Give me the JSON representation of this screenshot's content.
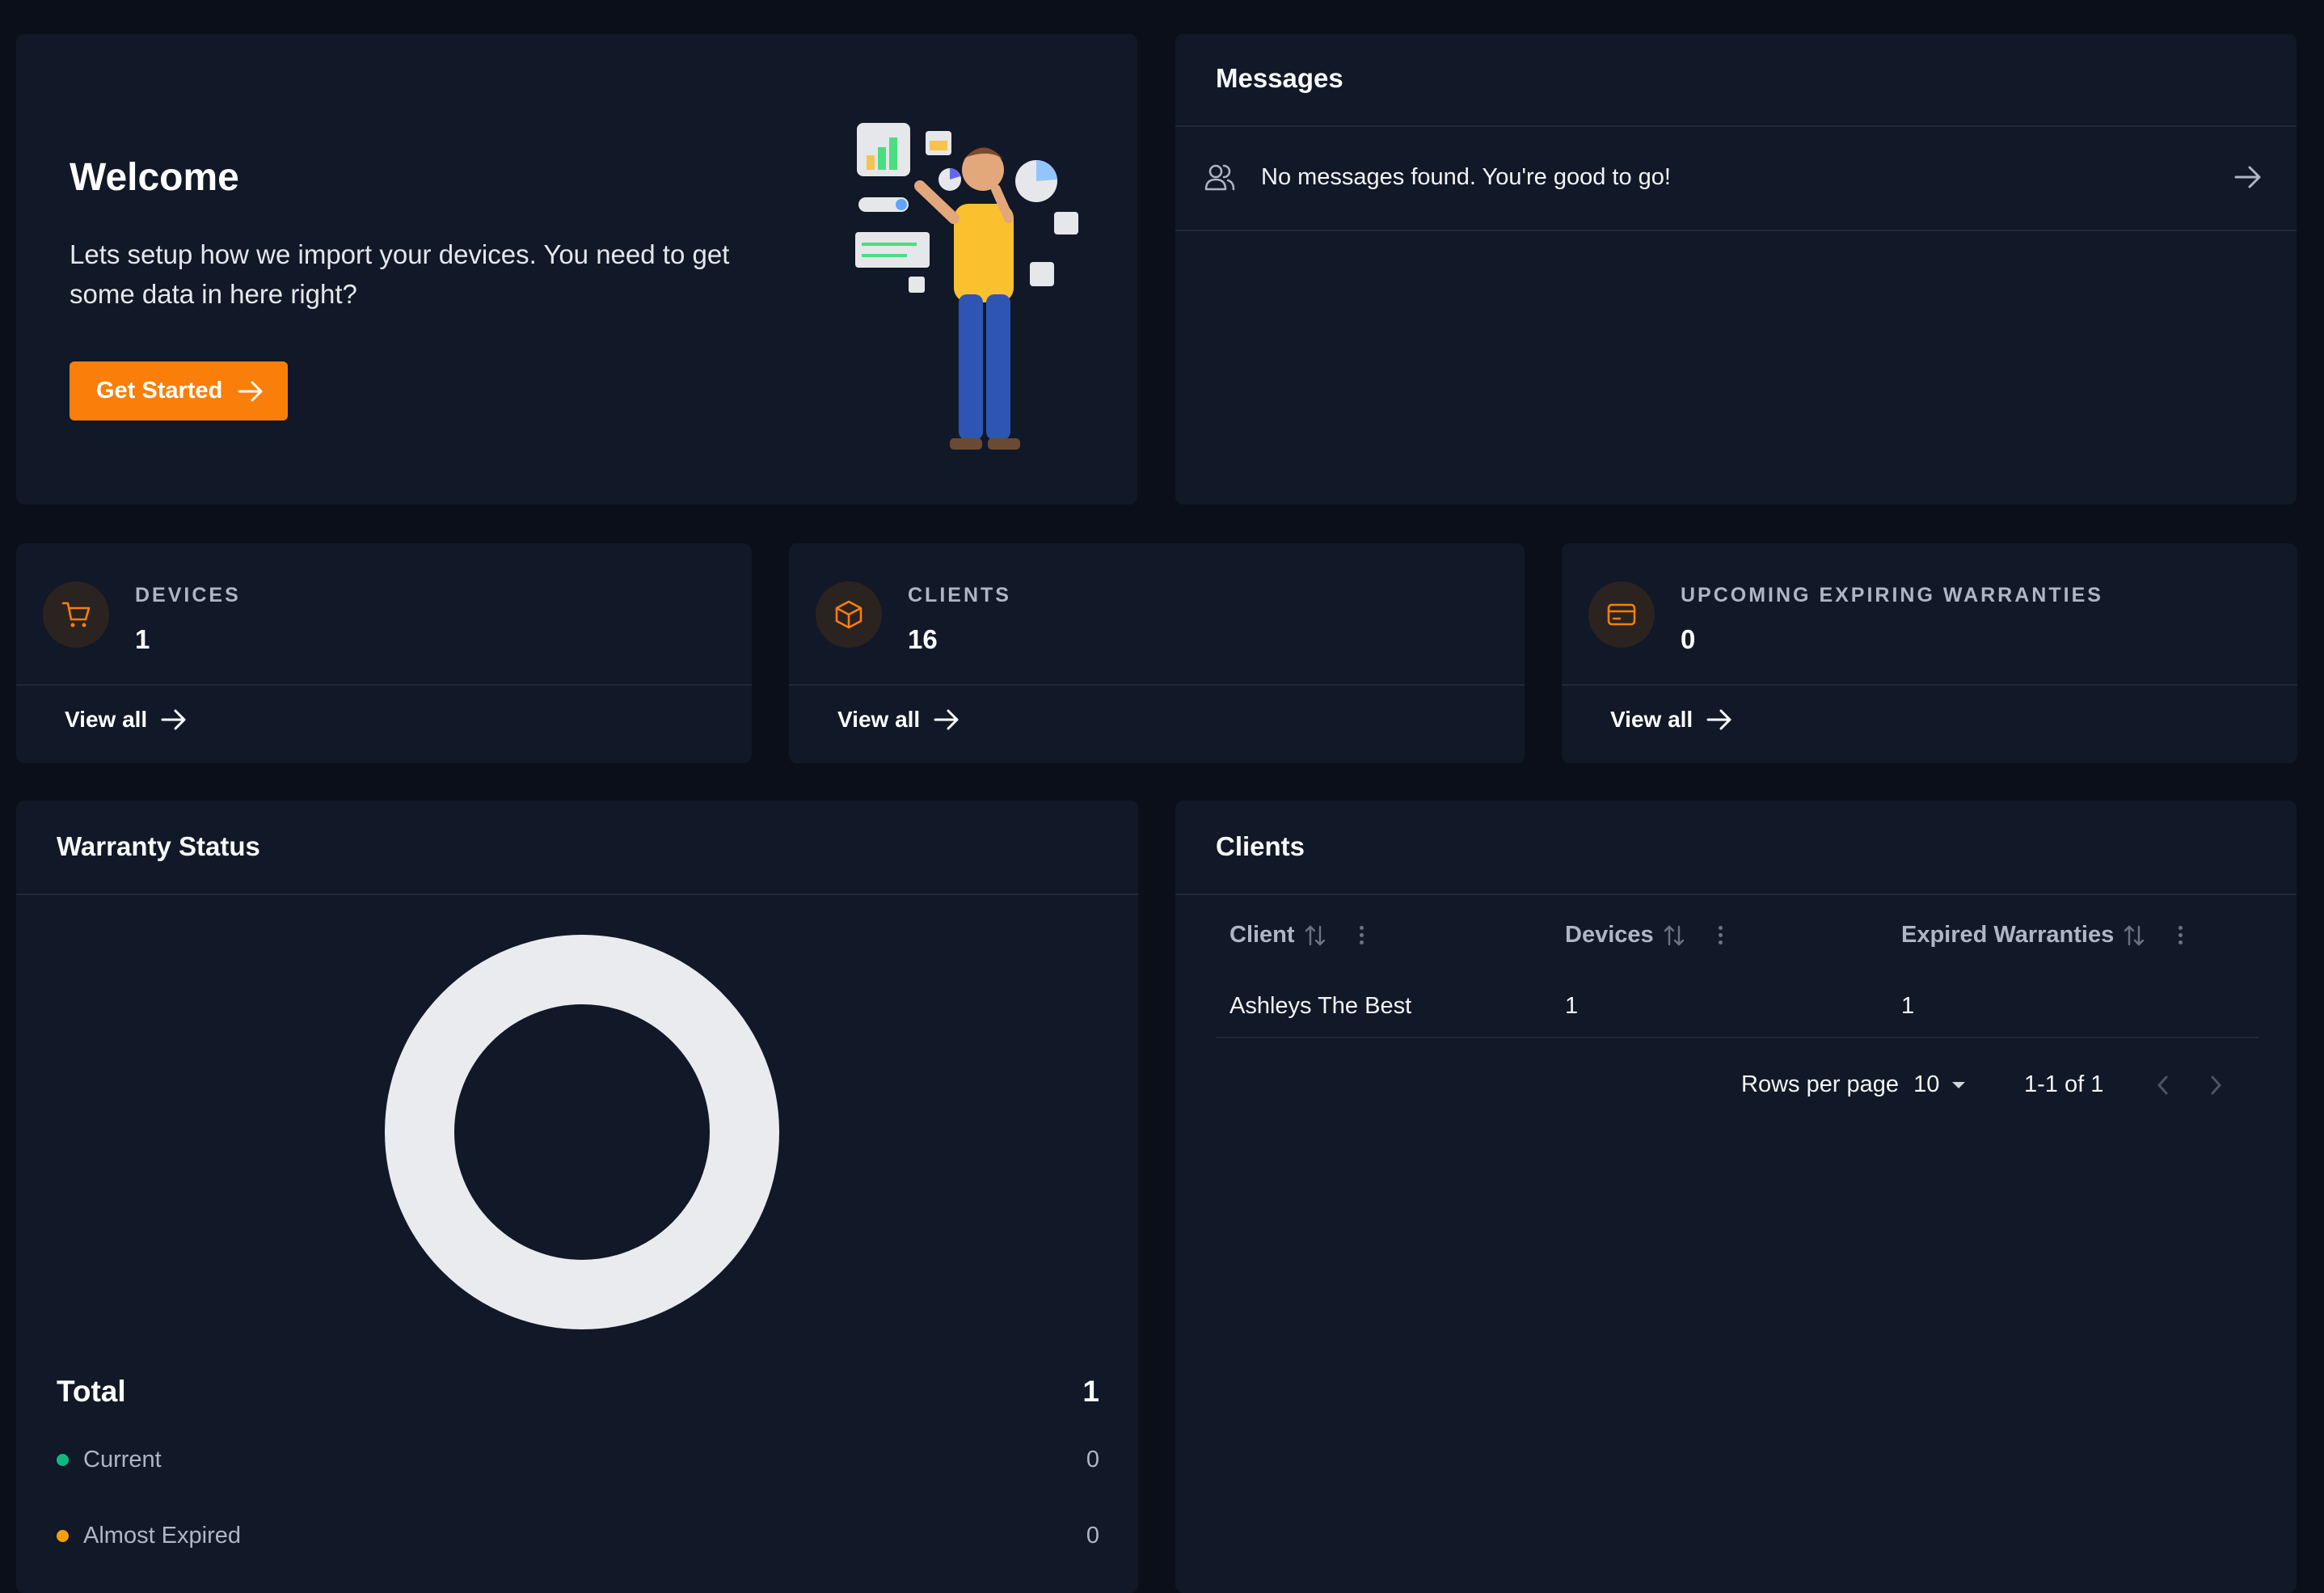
{
  "welcome": {
    "title": "Welcome",
    "text": "Lets setup how we import your devices. You need to get some data in here right?",
    "button_label": "Get Started"
  },
  "messages": {
    "title": "Messages",
    "empty_text": "No messages found. You're good to go!"
  },
  "stats": [
    {
      "label": "DEVICES",
      "value": "1",
      "link": "View all",
      "icon": "cart-icon"
    },
    {
      "label": "CLIENTS",
      "value": "16",
      "link": "View all",
      "icon": "box-icon"
    },
    {
      "label": "UPCOMING EXPIRING WARRANTIES",
      "value": "0",
      "link": "View all",
      "icon": "credit-card-icon"
    }
  ],
  "warranty": {
    "title": "Warranty Status",
    "total_label": "Total",
    "total_value": "1",
    "legend": [
      {
        "label": "Current",
        "value": "0",
        "color": "#10b981"
      },
      {
        "label": "Almost Expired",
        "value": "0",
        "color": "#f59e0b"
      }
    ]
  },
  "clients": {
    "title": "Clients",
    "columns": [
      "Client",
      "Devices",
      "Expired Warranties"
    ],
    "rows": [
      [
        "Ashleys The Best",
        "1",
        "1"
      ]
    ],
    "rows_per_page_label": "Rows per page",
    "rows_per_page_value": "10",
    "range_text": "1-1 of 1"
  },
  "colors": {
    "accent": "#f97f0a",
    "card_bg": "#111827",
    "page_bg": "#0b0f19",
    "donut": "#e9ebee"
  }
}
